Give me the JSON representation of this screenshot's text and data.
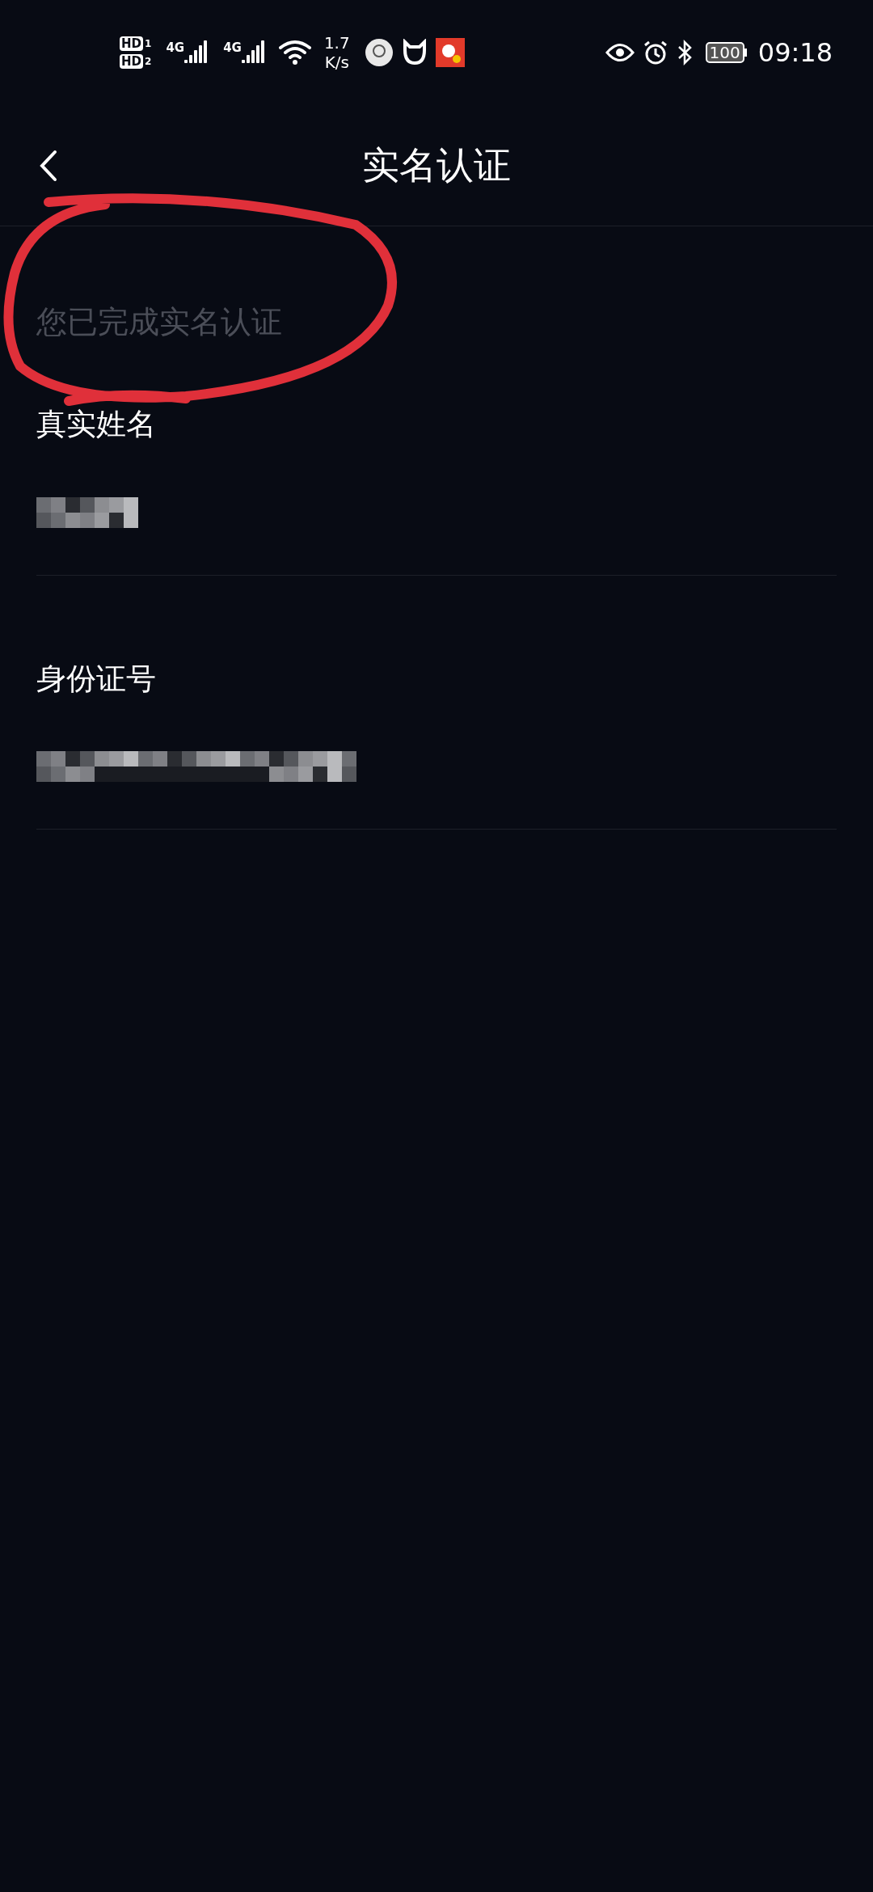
{
  "status_bar": {
    "sims": [
      {
        "label": "HD",
        "slot": "1"
      },
      {
        "label": "HD",
        "slot": "2"
      }
    ],
    "networks": [
      "4G",
      "4G"
    ],
    "speed": {
      "value": "1.7",
      "unit": "K/s"
    },
    "battery": "100",
    "time": "09:18"
  },
  "header": {
    "title": "实名认证"
  },
  "notice": "您已完成实名认证",
  "fields": [
    {
      "label": "真实姓名",
      "kind": "masked"
    },
    {
      "label": "身份证号",
      "kind": "masked"
    }
  ]
}
